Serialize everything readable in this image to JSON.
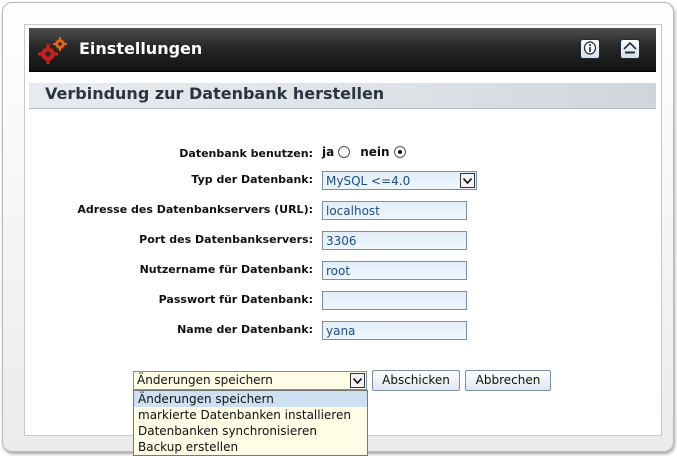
{
  "header": {
    "title": "Einstellungen",
    "icon": "gears-icon",
    "buttons": [
      {
        "icon": "info-icon"
      },
      {
        "icon": "home-icon"
      }
    ]
  },
  "section": {
    "title": "Verbindung zur Datenbank herstellen"
  },
  "form": {
    "use_db_label": "Datenbank benutzen:",
    "use_db_yes": "ja",
    "use_db_no": "nein",
    "use_db_selected": "nein",
    "db_type_label": "Typ der Datenbank:",
    "db_type_value": "MySQL <=4.0",
    "address_label": "Adresse des Datenbankservers (URL):",
    "address_value": "localhost",
    "port_label": "Port des Datenbankservers:",
    "port_value": "3306",
    "user_label": "Nutzername für Datenbank:",
    "user_value": "root",
    "password_label": "Passwort für Datenbank:",
    "password_value": "",
    "dbname_label": "Name der Datenbank:",
    "dbname_value": "yana"
  },
  "actions": {
    "selected": "Änderungen speichern",
    "options": [
      "Änderungen speichern",
      "markierte Datenbanken installieren",
      "Datenbanken synchronisieren",
      "Backup erstellen"
    ],
    "submit_label": "Abschicken",
    "cancel_label": "Abbrechen"
  },
  "colors": {
    "header_bg": "#1c1c1c",
    "field_bg": "#e8f1fb",
    "field_text": "#1d4c8b",
    "dropdown_bg": "#fffde6"
  }
}
